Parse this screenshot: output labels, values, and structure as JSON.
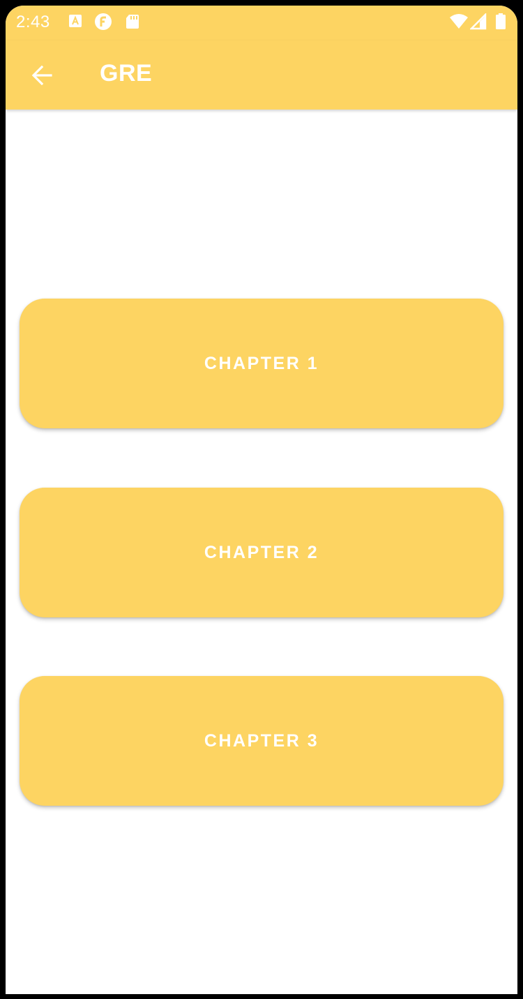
{
  "status_bar": {
    "time": "2:43",
    "left_icons": [
      "font-a-icon",
      "round-f-icon",
      "sd-card-icon"
    ],
    "right_icons": [
      "wifi-icon",
      "cell-signal-icon",
      "battery-icon"
    ]
  },
  "app_bar": {
    "back_icon": "arrow-left-icon",
    "title": "GRE"
  },
  "chapters": [
    {
      "label": "CHAPTER 1"
    },
    {
      "label": "CHAPTER 2"
    },
    {
      "label": "CHAPTER 3"
    }
  ],
  "colors": {
    "primary": "#fdd462",
    "on_primary": "#ffffff",
    "background": "#ffffff"
  }
}
